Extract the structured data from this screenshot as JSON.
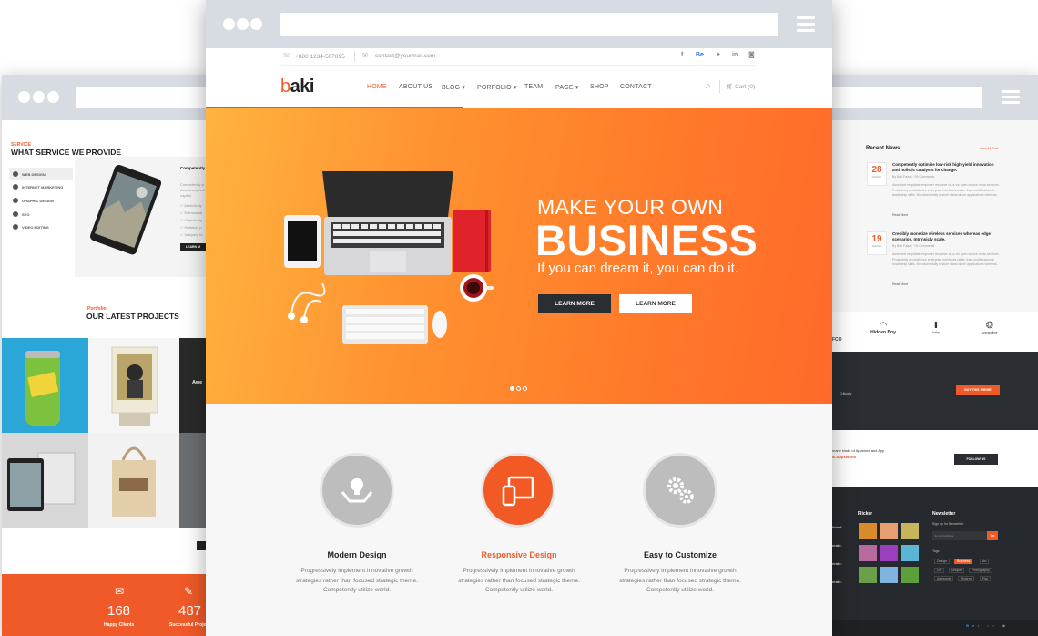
{
  "left": {
    "services": {
      "eyebrow": "SERVICE",
      "title": "WHAT SERVICE WE PROVIDE",
      "items": [
        "WEB DESIGN",
        "INTERNET MARKETING",
        "GRAPHIC DESIGN",
        "SEO",
        "VIDEO EDITING"
      ],
      "side_title": "Competently holistic catal",
      "side_text_1": "Competently p",
      "side_text_2": "Assertively holi",
      "side_text_3": "capital.",
      "checks": [
        "Assertively",
        "Enthusiasti",
        "Objectively",
        "Holisticly p",
        "Uniquely to"
      ],
      "cta": "LEARN M"
    },
    "portfolio": {
      "eyebrow": "Portfolio",
      "title": "OUR LATEST PROJECTS",
      "aw": "Awe"
    },
    "stats": [
      {
        "value": "168",
        "label": "Happy Clients"
      },
      {
        "value": "487",
        "label": "Successful Projec"
      }
    ]
  },
  "main": {
    "topbar": {
      "phone": "+880 1234-567895",
      "email": "contact@yourmail.com",
      "social_be": "Be"
    },
    "logo": {
      "b": "b",
      "rest": "aki"
    },
    "nav": [
      "HOME",
      "ABOUT US",
      "BLOG",
      "PORFOLIO",
      "TEAM",
      "PAGE",
      "SHOP",
      "CONTACT"
    ],
    "cart": "Cart (0)",
    "hero": {
      "line1": "MAKE YOUR OWN",
      "line2": "BUSINESS",
      "sub": "If you can dream it, you can do it.",
      "btn1": "LEARN MORE",
      "btn2": "LEARN MORE"
    },
    "features": [
      {
        "title": "Modern Design",
        "text": "Progressively implement innovative growth strategies rather than focused strategic theme. Competently utilize world."
      },
      {
        "title": "Responsive Design",
        "text": "Progressively implement innovative growth strategies rather than focused strategic theme. Competently utilize world."
      },
      {
        "title": "Easy to Customize",
        "text": "Progressively implement innovative growth strategies rather than focused strategic theme. Competently utilize world."
      }
    ]
  },
  "right": {
    "news": {
      "title": "Recent News",
      "view_all": "View All Post",
      "items": [
        {
          "day": "28",
          "month": "October",
          "title": "Competently optimize low-risk high-yield innovation and holistic catalysts for change.",
          "meta": "By Bati Faisal  ·  05 Comments",
          "text": "Assertivel negotiate empower resource ok-a-vis open source meta-services. Proactively revolutionize enterprise interfaces rather than multifunctional leadership skills. Monotonectally restore stand alone applications whereas.",
          "read": "Read More"
        },
        {
          "day": "19",
          "month": "October",
          "title": "Credibly monetize wireless services whereas edge scenarios. Intrinsicly scale.",
          "meta": "By Bati Faisal  ·  05 Comments",
          "text": "Assertivel negotiate empower resource ok-a-vis open source meta-services. Proactively revolutionize enterprise interfaces rather than multifunctional leadership skills. Monotonectally restore stand alone applications whereas.",
          "read": "Read More"
        }
      ]
    },
    "brands": [
      "FCO",
      "Hidden Boy",
      "baby",
      "wooster"
    ],
    "promo": {
      "text": "Critically",
      "btn": "BUY THIS THEME"
    },
    "appstore": {
      "text1": "many kinds of Appstore and App",
      "text2": "ik-AppsWorld",
      "btn": "FOLLOW US"
    },
    "footer": {
      "flicker": "Flicker",
      "newsletter": "Newsletter",
      "signup": "Sign up for Newsletter",
      "email_ph": "E-mail Address",
      "go": "Go",
      "tags_title": "Tags",
      "tags": [
        "Design",
        "Business",
        "Art",
        "UX",
        "Unique",
        "Photography",
        "Awesome",
        "Modern",
        "Flat"
      ],
      "left_words": [
        "ished",
        "erate.",
        "erate.",
        "erate."
      ]
    }
  },
  "colors": {
    "accent": "#f05a28",
    "orange": "#ff7e2a",
    "dark": "#2a2d32",
    "chrome": "#d7dce3"
  }
}
